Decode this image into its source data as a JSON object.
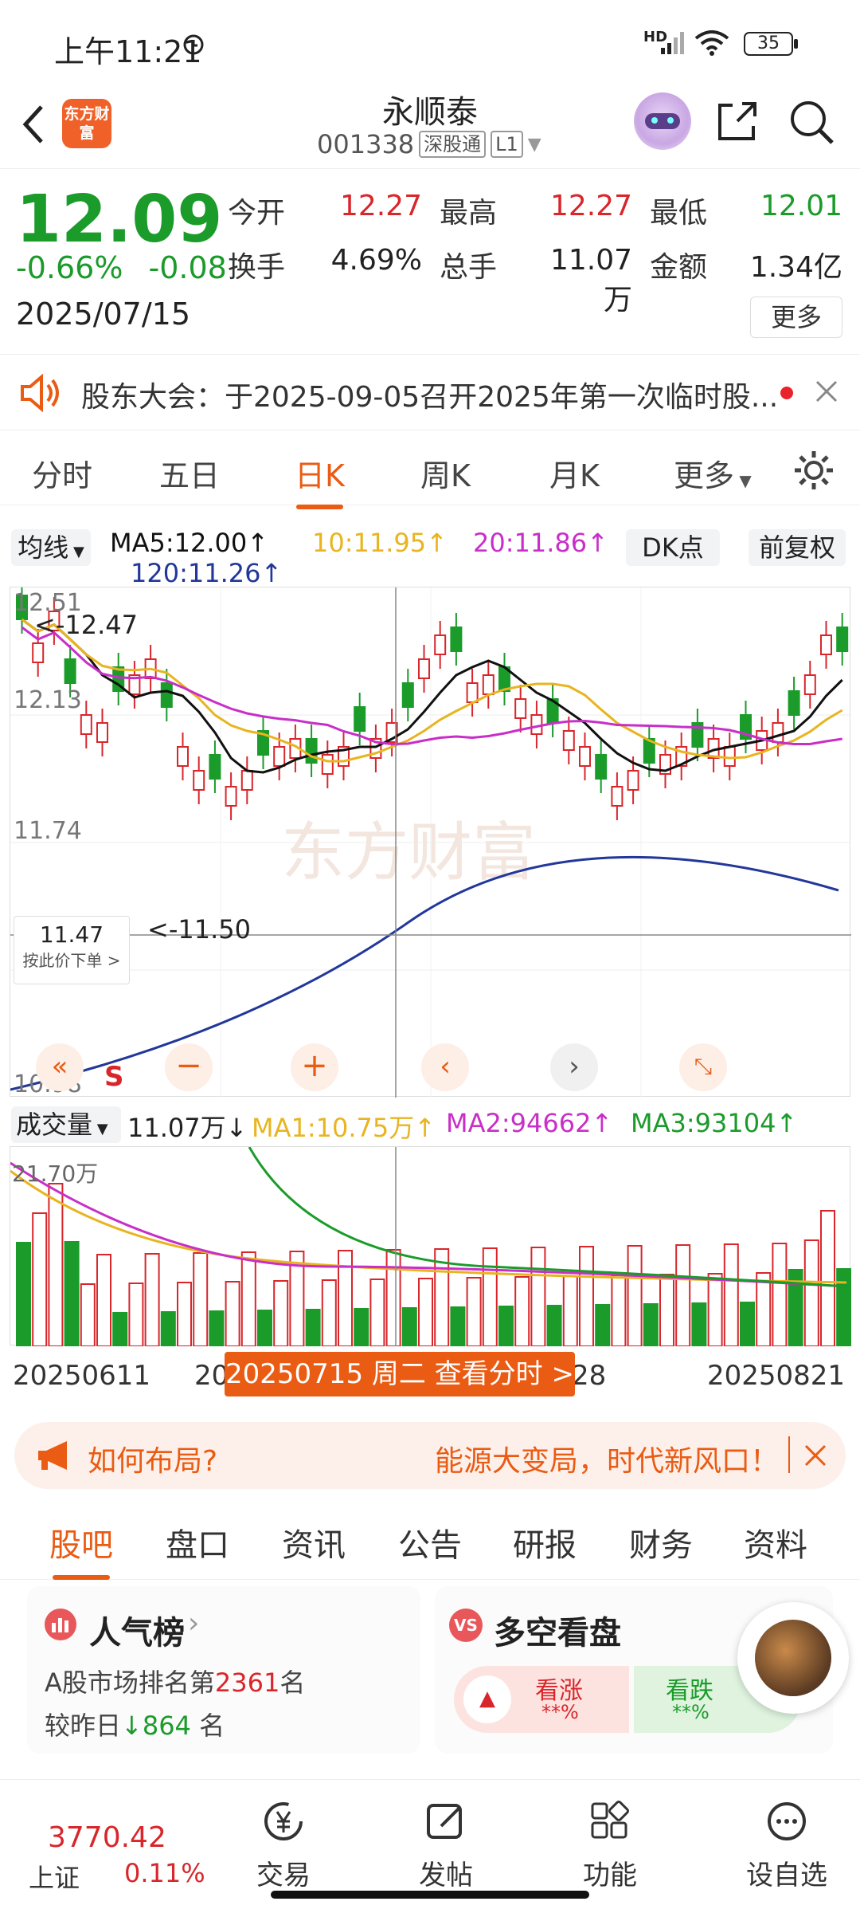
{
  "status": {
    "time": "上午11:21",
    "network": "HD",
    "battery": "35"
  },
  "header": {
    "logo_text": "东方财富",
    "title": "永顺泰",
    "code": "001338",
    "badge": "深股通",
    "level": "L1"
  },
  "quote": {
    "price": "12.09",
    "change_pct": "-0.66%",
    "change": "-0.08",
    "date": "2025/07/15",
    "fields": [
      {
        "label": "今开",
        "value": "12.27",
        "color": "red"
      },
      {
        "label": "最高",
        "value": "12.27",
        "color": "red"
      },
      {
        "label": "最低",
        "value": "12.01",
        "color": "green"
      },
      {
        "label": "换手",
        "value": "4.69%",
        "color": "black"
      },
      {
        "label": "总手",
        "value": "11.07万",
        "color": "black"
      },
      {
        "label": "金额",
        "value": "1.34亿",
        "color": "black"
      }
    ],
    "more": "更多"
  },
  "notice": {
    "text": "股东大会：于2025-09-05召开2025年第一次临时股..."
  },
  "chart_tabs": [
    "分时",
    "五日",
    "日K",
    "周K",
    "月K",
    "更多"
  ],
  "active_chart_tab": "日K",
  "ma_bar": {
    "indicator": "均线",
    "ma5": "MA5:12.00↑",
    "ma10": "10:11.95↑",
    "ma20": "20:11.86↑",
    "ma120": "120:11.26↑",
    "dk": "DK点",
    "fq": "前复权"
  },
  "kline": {
    "y_labels": [
      "12.51",
      "12.13",
      "11.74",
      "10.98"
    ],
    "high_marker": "<-12.47",
    "low_marker": "<-11.50",
    "crosshair_price": "11.47",
    "order_hint": "按此价下单 >",
    "sell_mark": "S",
    "watermark": "东方财富"
  },
  "volume_bar": {
    "label": "成交量",
    "value": "11.07万↓",
    "ma1": "MA1:10.75万↑",
    "ma2": "MA2:94662↑",
    "ma3": "MA3:93104↑",
    "max_label": "21.70万"
  },
  "x_axis": {
    "start": "20250611",
    "mid_left": "20",
    "mid_right": "28",
    "end": "20250821"
  },
  "date_popup": "20250715 周二 查看分时 >",
  "ad": {
    "question": "如何布局?",
    "slogan": "能源大变局，时代新风口！"
  },
  "section_tabs": [
    "股吧",
    "盘口",
    "资讯",
    "公告",
    "研报",
    "财务",
    "资料"
  ],
  "active_section": "股吧",
  "popularity": {
    "title": "人气榜",
    "rank_prefix": "A股市场排名第",
    "rank": "2361",
    "rank_suffix": "名",
    "compare_prefix": "较昨日",
    "compare_value": "864",
    "compare_suffix": "名"
  },
  "bullbear": {
    "title": "多空看盘",
    "up": "看涨",
    "up_pct": "**%",
    "down": "看跌",
    "down_pct": "**%"
  },
  "bottom_nav": {
    "index_value": "3770.42",
    "index_name": "上证",
    "index_change": "0.11%",
    "items": [
      "交易",
      "发帖",
      "功能",
      "设自选"
    ]
  }
}
